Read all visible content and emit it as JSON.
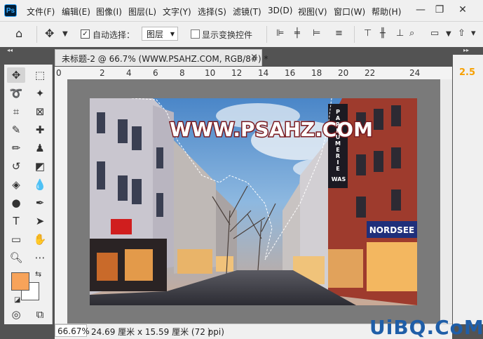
{
  "app": {
    "logo": "Ps"
  },
  "menu": [
    "文件(F)",
    "编辑(E)",
    "图像(I)",
    "图层(L)",
    "文字(Y)",
    "选择(S)",
    "滤镜(T)",
    "3D(D)",
    "视图(V)",
    "窗口(W)",
    "帮助(H)"
  ],
  "window_controls": {
    "minimize": "—",
    "restore": "❐",
    "close": "✕"
  },
  "options": {
    "auto_select_label": "自动选择：",
    "auto_select_checked": "✓",
    "layer_select_value": "图层",
    "show_transform_label": "显示变换控件"
  },
  "document": {
    "tab_title": "未标题-2 @ 66.7% (WWW.PSAHZ.COM, RGB/8#) *",
    "tab_close": "×",
    "image_text": "WWW.PSAHZ.COM",
    "sign_text": "PARFUMERIE",
    "sign_text2": "WAS",
    "shop_sign": "NORDSEE"
  },
  "ruler": {
    "ticks": [
      "0",
      "2",
      "4",
      "6",
      "8",
      "10",
      "12",
      "14",
      "16",
      "18",
      "20",
      "22",
      "24"
    ]
  },
  "right_panel": {
    "value": "2.5"
  },
  "status": {
    "zoom": "66.67%",
    "doc_info": "24.69 厘米 x 15.59 厘米 (72 ppi)",
    "arrow": "〉"
  },
  "watermark": "UiBQ.CoM",
  "colors": {
    "foreground": "#f7a35a",
    "background": "#ffffff",
    "accent": "#31a8ff"
  }
}
